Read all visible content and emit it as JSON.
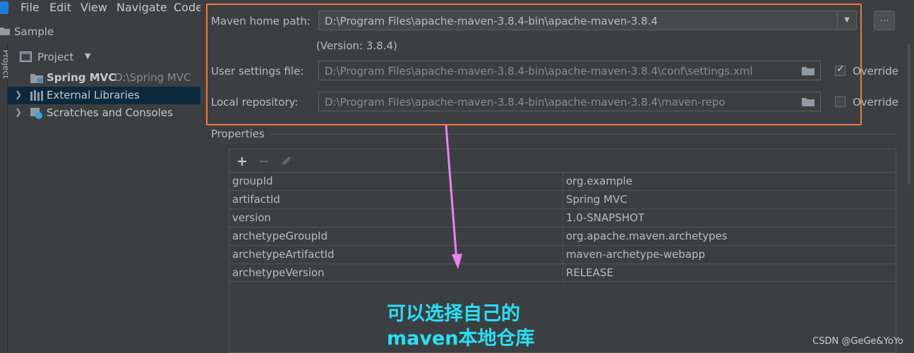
{
  "menu": [
    "File",
    "Edit",
    "View",
    "Navigate",
    "Code"
  ],
  "breadcrumb": "Sample",
  "side_tab": "Project",
  "project": {
    "selector_label": "Project",
    "tree": [
      {
        "name": "Spring MVC",
        "path": "D:\\Spring MVC"
      },
      {
        "name": "External Libraries"
      },
      {
        "name": "Scratches and Consoles"
      }
    ]
  },
  "maven": {
    "home_label": "Maven home path:",
    "home_value": "D:\\Program Files\\apache-maven-3.8.4-bin\\apache-maven-3.8.4",
    "browse_label": "...",
    "version": "(Version: 3.8.4)",
    "settings_label": "User settings file:",
    "settings_value": "D:\\Program Files\\apache-maven-3.8.4-bin\\apache-maven-3.8.4\\conf\\settings.xml",
    "settings_override_label": "Override",
    "repo_label": "Local repository:",
    "repo_value": "D:\\Program Files\\apache-maven-3.8.4-bin\\apache-maven-3.8.4\\maven-repo",
    "repo_override_label": "Override"
  },
  "properties": {
    "title": "Properties",
    "toolbar": {
      "add": "+",
      "remove": "−"
    },
    "rows": [
      {
        "key": "groupId",
        "value": "org.example"
      },
      {
        "key": "artifactId",
        "value": "Spring MVC"
      },
      {
        "key": "version",
        "value": "1.0-SNAPSHOT"
      },
      {
        "key": "archetypeGroupId",
        "value": "org.apache.maven.archetypes"
      },
      {
        "key": "archetypeArtifactId",
        "value": "maven-archetype-webapp"
      },
      {
        "key": "archetypeVersion",
        "value": "RELEASE"
      }
    ]
  },
  "annotation": {
    "line1": "可以选择自己的",
    "line2": "maven本地仓库",
    "color": "#27e0f5",
    "highlight_color": "#ef7a3e",
    "arrow_color": "#ee82ee"
  },
  "watermark": "CSDN @GeGe&YoYo"
}
